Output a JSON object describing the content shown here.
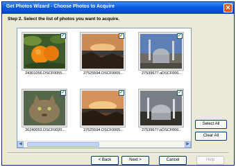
{
  "window": {
    "title": "Get Photos Wizard - Choose Photos to Acquire",
    "close_glyph": "✕"
  },
  "step_label": "Step 2. Select the list of photos you want to acquire.",
  "photos": [
    {
      "caption": "24301056.DSCF0055...",
      "checked": true,
      "icon": "oranges-photo"
    },
    {
      "caption": "27525594.DSCF0005...",
      "checked": true,
      "icon": "sunset-photo"
    },
    {
      "caption": "27539677.aDSCF006...",
      "checked": true,
      "icon": "mosque-photo"
    },
    {
      "caption": "26240053.DSCF0020...",
      "checked": true,
      "icon": "cat-photo"
    },
    {
      "caption": "27525594.DSCF0005...",
      "checked": true,
      "icon": "sunset-photo"
    },
    {
      "caption": "27539677.bDSCF006...",
      "checked": true,
      "icon": "mosque-photo"
    }
  ],
  "check_glyph": "✓",
  "scroll": {
    "left_arrow": "◀",
    "right_arrow": "▶"
  },
  "side_buttons": {
    "select_all": "Select All",
    "clear_all": "Clear All"
  },
  "footer_buttons": {
    "back": "< Back",
    "next": "Next >",
    "cancel": "Cancel",
    "help": "Help"
  },
  "colors": {
    "title_bar": "#0a5ae0",
    "close_button": "#e0541e",
    "dialog_bg": "#ece9d8",
    "check_mark": "#21a121"
  }
}
